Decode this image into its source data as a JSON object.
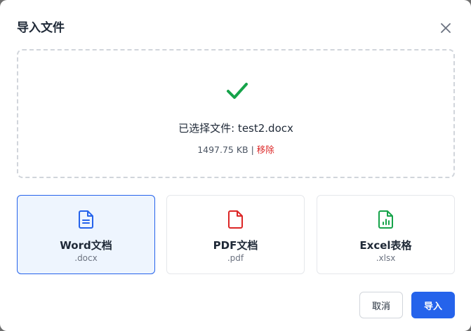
{
  "dialog": {
    "title": "导入文件",
    "close_icon": "close-icon"
  },
  "dropzone": {
    "status_icon": "check-icon",
    "selected_label": "已选择文件: test2.docx",
    "file_size": "1497.75 KB",
    "separator": " | ",
    "remove_label": "移除"
  },
  "formats": [
    {
      "label": "Word文档",
      "ext": ".docx",
      "icon": "document-icon",
      "color": "#2563eb",
      "selected": true
    },
    {
      "label": "PDF文档",
      "ext": ".pdf",
      "icon": "file-icon",
      "color": "#dc2626",
      "selected": false
    },
    {
      "label": "Excel表格",
      "ext": ".xlsx",
      "icon": "spreadsheet-icon",
      "color": "#16a34a",
      "selected": false
    }
  ],
  "actions": {
    "cancel_label": "取消",
    "import_label": "导入"
  },
  "colors": {
    "accent": "#2563eb",
    "success": "#16a34a",
    "danger": "#dc2626"
  }
}
